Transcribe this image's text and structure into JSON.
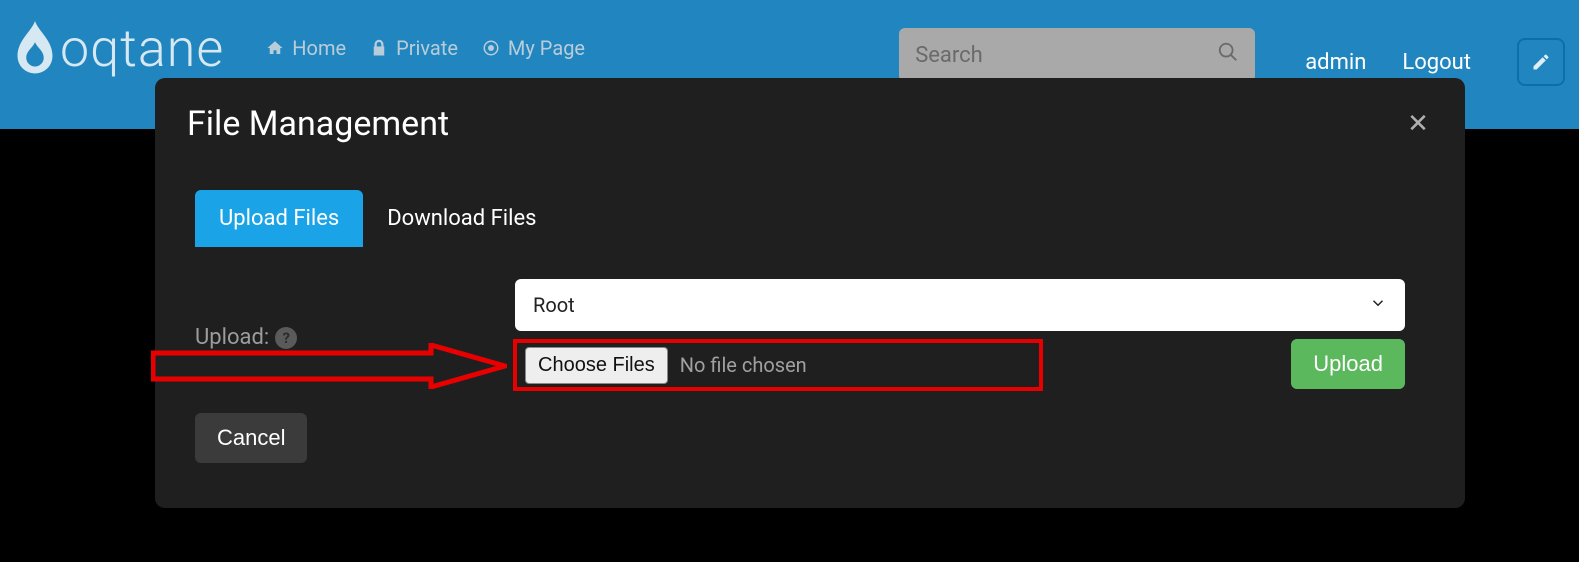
{
  "header": {
    "logo_text": "oqtane",
    "nav": [
      {
        "label": "Home",
        "icon": "home-icon"
      },
      {
        "label": "Private",
        "icon": "lock-icon"
      },
      {
        "label": "My Page",
        "icon": "target-icon"
      }
    ],
    "search_placeholder": "Search",
    "user_links": {
      "username": "admin",
      "logout": "Logout"
    }
  },
  "modal": {
    "title": "File Management",
    "tabs": [
      {
        "label": "Upload Files",
        "active": true
      },
      {
        "label": "Download Files",
        "active": false
      }
    ],
    "form": {
      "upload_label": "Upload:",
      "folder_select": {
        "value": "Root"
      },
      "file_input": {
        "button_label": "Choose Files",
        "status_text": "No file chosen"
      },
      "upload_button": "Upload",
      "cancel_button": "Cancel"
    }
  }
}
